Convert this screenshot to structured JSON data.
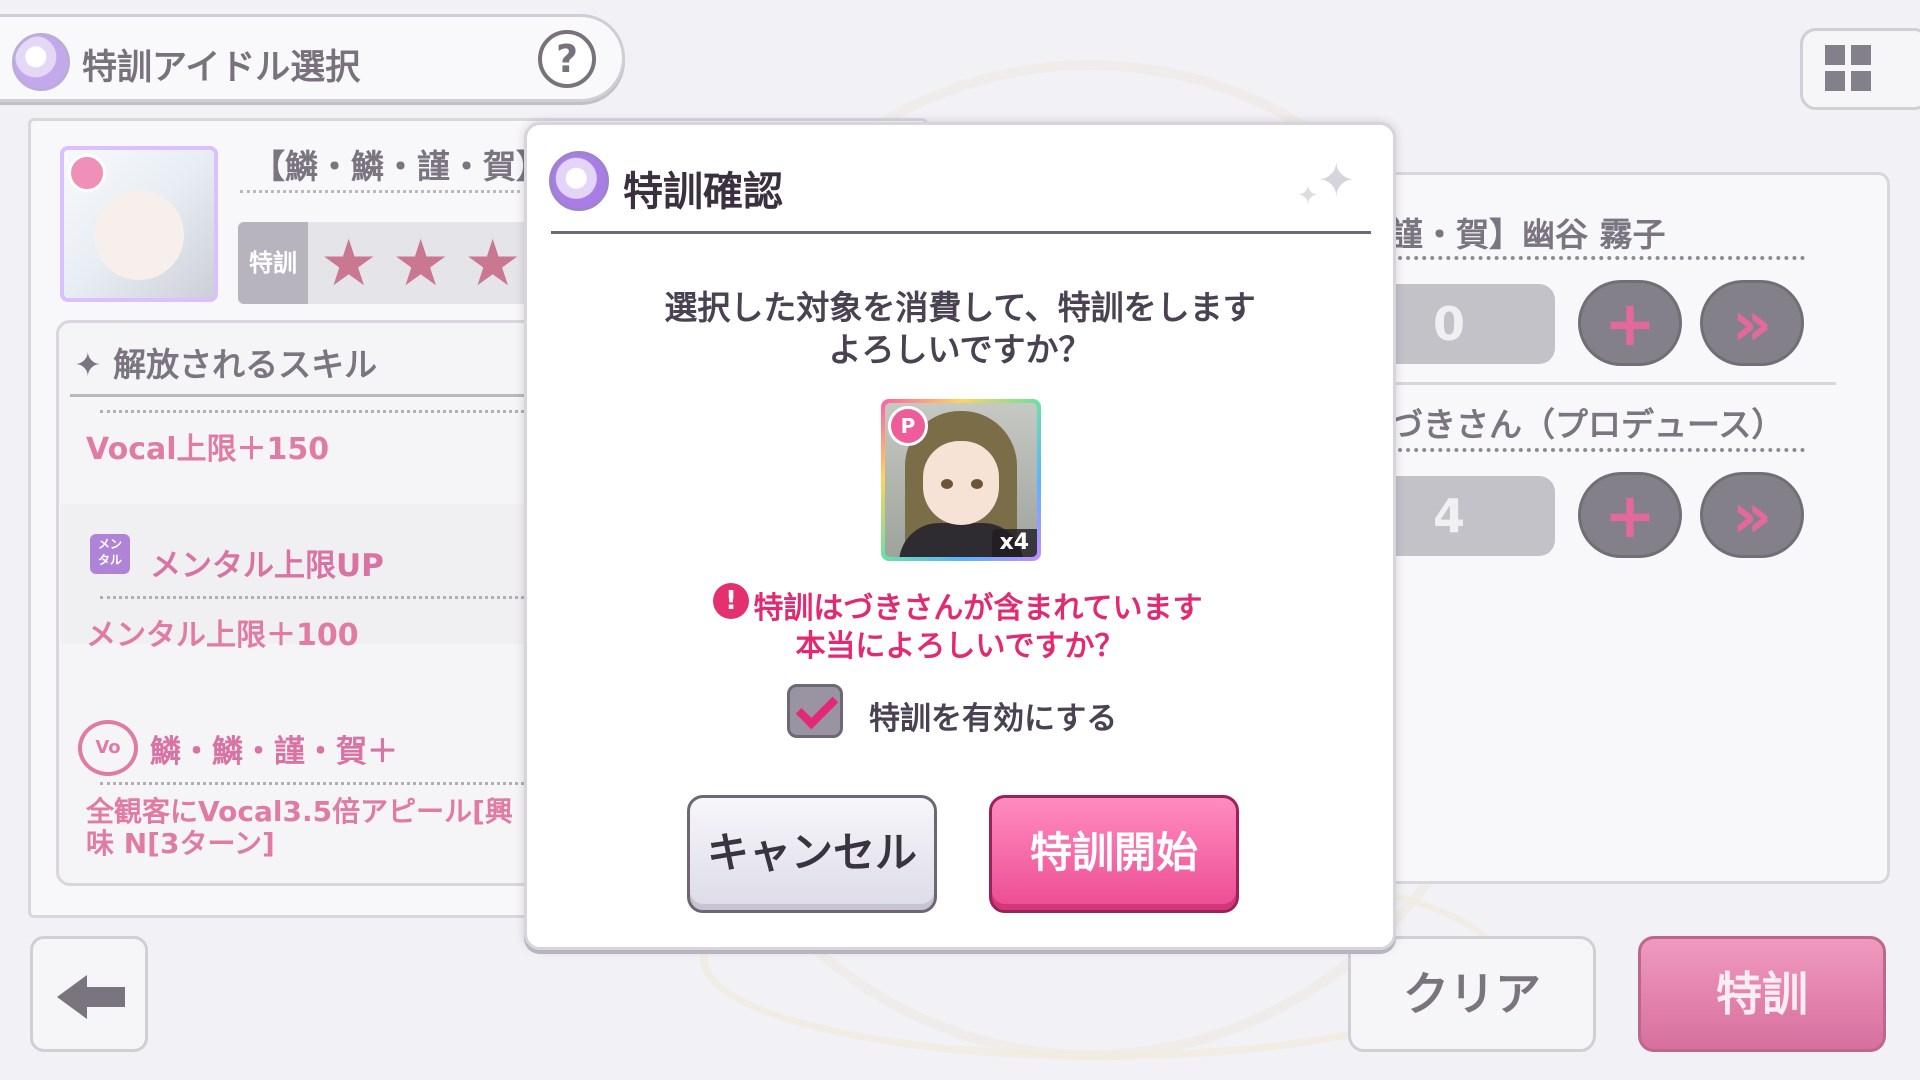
{
  "screen": {
    "title": "特訓アイドル選択",
    "help_glyph": "?"
  },
  "left": {
    "card_name": "【鱗・鱗・謹・賀】",
    "tokkun_label": "特訓",
    "stars_glyph": "★",
    "skill_header": "✦ 解放されるスキル",
    "skills": [
      {
        "text": "Vocal上限＋150"
      },
      {
        "title": "メンタル上限UP",
        "icon_text": "メン タル",
        "text": "メンタル上限＋100"
      },
      {
        "title": "鱗・鱗・謹・賀＋",
        "icon_text": "Vo",
        "text": "全観客にVocal3.5倍アピール[興味 N[3ターン]"
      }
    ]
  },
  "right": {
    "rows": [
      {
        "name": "謹・賀】幽谷 霧子",
        "qty": "0"
      },
      {
        "name": "づきさん（プロデュース）",
        "qty": "4"
      }
    ],
    "plus_glyph": "+",
    "max_glyph": "»"
  },
  "footer": {
    "clear_label": "クリア",
    "tokkun_label": "特訓"
  },
  "dialog": {
    "title": "特訓確認",
    "message_line1": "選択した対象を消費して、特訓をします",
    "message_line2": "よろしいですか？",
    "item_badge": "P",
    "item_count": "x4",
    "warning_glyph": "!",
    "warning_line1": "特訓はづきさんが含まれています",
    "warning_line2": "本当によろしいですか？",
    "checkbox_label": "特訓を有効にする",
    "checkbox_checked": true,
    "cancel_label": "キャンセル",
    "confirm_label": "特訓開始"
  },
  "colors": {
    "accent_pink": "#e22a72",
    "dark_button": "#4b4452"
  }
}
